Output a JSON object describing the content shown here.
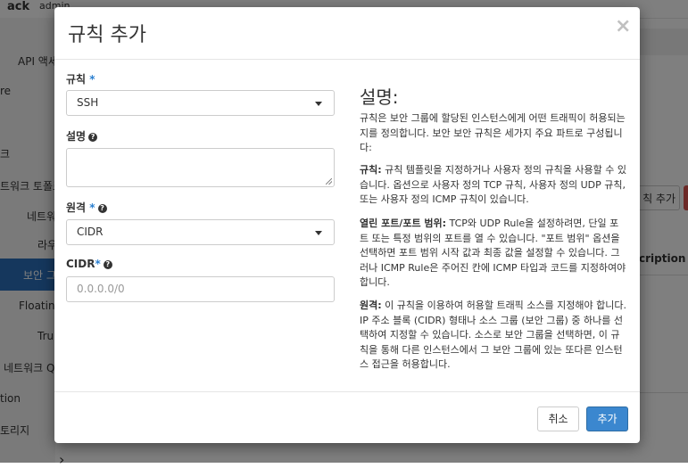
{
  "background": {
    "logo": "ack",
    "user": "admin",
    "sidebar": [
      "API 액세",
      "re",
      "크",
      "트워크 토폴로",
      "네트워",
      "라우",
      "보안 그",
      "Floating",
      "Trun",
      "네트워크 Q",
      "tion",
      "토리지"
    ],
    "add_rule_button": "칙 추가",
    "column_header": "cription",
    "chevron": "›"
  },
  "modal": {
    "title": "규칙 추가",
    "close": "×",
    "fields": {
      "rule": {
        "label": "규칙",
        "required_mark": "*",
        "value": "SSH"
      },
      "description": {
        "label": "설명",
        "value": ""
      },
      "remote": {
        "label": "원격",
        "required_mark": "*",
        "value": "CIDR"
      },
      "cidr": {
        "label": "CIDR",
        "required_mark": "*",
        "placeholder": "0.0.0.0/0"
      }
    },
    "help": {
      "title": "설명:",
      "intro": "규칙은 보안 그룹에 할당된 인스턴스에게 어떤 트래픽이 허용되는지를 정의합니다. 보안 보안 규칙은 세가지 주요 파트로 구성됩니다:",
      "rule_term": "규칙:",
      "rule_text": " 규칙 템플릿을 지정하거나 사용자 정의 규칙을 사용할 수 있습니다. 옵션으로 사용자 정의 TCP 규칙, 사용자 정의 UDP 규칙, 또는 사용자 정의 ICMP 규칙이 있습니다.",
      "port_term": "열린 포트/포트 범위:",
      "port_text": " TCP와 UDP Rule을 설정하려면, 단일 포트 또는 특정 범위의 포트를 열 수 있습니다. \"포트 범위\" 옵션을 선택하면 포트 범위 시작 값과 최종 값을 설정할 수 있습니다. 그러나 ICMP Rule은 주어진 칸에 ICMP 타입과 코드를 지정하여야 합니다.",
      "remote_term": "원격:",
      "remote_text": " 이 규칙을 이용하여 허용할 트래픽 소스를 지정해야 합니다. IP 주소 블록 (CIDR) 형태나 소스 그룹 (보안 그룹) 중 하나를 선택하여 지정할 수 있습니다. 소스로 보안 그룹을 선택하면, 이 규칙을 통해 다른 인스턴스에서 그 보안 그룹에 있는 또다른 인스턴스 접근을 허용합니다."
    },
    "buttons": {
      "cancel": "취소",
      "add": "추가"
    }
  },
  "colors": {
    "primary": "#3b87cf",
    "required": "#2a7fd0",
    "sidebar_active": "#2a6ebb"
  },
  "icons": [
    "close-icon",
    "help-icon",
    "caret-down-icon",
    "chevron-right-icon"
  ]
}
